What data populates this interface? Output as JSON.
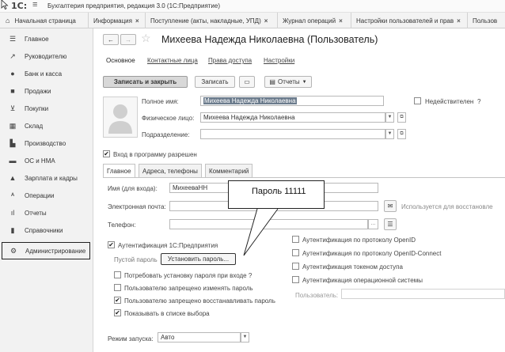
{
  "window": {
    "logo": "1С:",
    "title": "Бухгалтерия предприятия, редакция 3.0  (1С:Предприятие)"
  },
  "tabs": {
    "home": "Начальная страница",
    "items": [
      {
        "label": "Информация"
      },
      {
        "label": "Поступление (акты, накладные, УПД)"
      },
      {
        "label": "Журнал операций"
      },
      {
        "label": "Настройки пользователей и прав"
      },
      {
        "label": "Пользов"
      }
    ],
    "close_glyph": "×"
  },
  "sidebar": {
    "items": [
      {
        "label": "Главное",
        "icon": "menu-icon"
      },
      {
        "label": "Руководителю",
        "icon": "chart-line-icon"
      },
      {
        "label": "Банк и касса",
        "icon": "ruble-icon"
      },
      {
        "label": "Продажи",
        "icon": "bag-icon"
      },
      {
        "label": "Покупки",
        "icon": "cart-icon"
      },
      {
        "label": "Склад",
        "icon": "grid-icon"
      },
      {
        "label": "Производство",
        "icon": "factory-icon"
      },
      {
        "label": "ОС и НМА",
        "icon": "truck-icon"
      },
      {
        "label": "Зарплата и кадры",
        "icon": "person-icon"
      },
      {
        "label": "Операции",
        "icon": "operations-icon"
      },
      {
        "label": "Отчеты",
        "icon": "bar-chart-icon"
      },
      {
        "label": "Справочники",
        "icon": "book-icon"
      },
      {
        "label": "Администрирование",
        "icon": "gear-icon",
        "active": true
      }
    ]
  },
  "form": {
    "title": "Михеева Надежда Николаевна (Пользователь)",
    "nav": {
      "main": "Основное",
      "contacts": "Контактные лица",
      "access": "Права доступа",
      "settings": "Настройки"
    },
    "toolbar": {
      "save_close": "Записать и закрыть",
      "save": "Записать",
      "reports": "Отчеты"
    },
    "full_name_label": "Полное имя:",
    "full_name_value": "Михеева Надежда Николаевна",
    "inactive_label": "Недействителен",
    "help_glyph": "?",
    "person_label": "Физическое лицо:",
    "person_value": "Михеева Надежда Николаевна",
    "dept_label": "Подразделение:",
    "dept_value": "",
    "login_allowed": "Вход в программу разрешен",
    "subtabs": [
      "Главное",
      "Адреса, телефоны",
      "Комментарий"
    ],
    "login_name_label": "Имя (для входа):",
    "login_name_value": "МихееваНН",
    "email_label": "Электронная почта:",
    "email_value": "",
    "email_restore": "Используется для восстановле",
    "phone_label": "Телефон:",
    "phone_value": "",
    "auth_1c": "Аутентификация 1С:Предприятия",
    "empty_password": "Пустой пароль",
    "set_password": "Установить пароль...",
    "require_change": "Потребовать установку пароля при входе",
    "deny_change": "Пользователю запрещено изменять пароль",
    "deny_restore": "Пользователю запрещено восстанавливать пароль",
    "show_in_list": "Показывать в списке выбора",
    "openid": "Аутентификация по протоколу OpenID",
    "openid_connect": "Аутентификация по протоколу OpenID-Connect",
    "token_auth": "Аутентификация токеном доступа",
    "os_auth": "Аутентификация операционной системы",
    "os_user_label": "Пользователь:",
    "os_user_value": "",
    "launch_mode_label": "Режим запуска:",
    "launch_mode_value": "Авто",
    "checks": {
      "inactive": false,
      "login_allowed": true,
      "auth_1c": true,
      "require_change": false,
      "deny_change": false,
      "deny_restore": true,
      "show_in_list": true,
      "openid": false,
      "openid_connect": false,
      "token_auth": false,
      "os_auth": false
    }
  },
  "callout": {
    "text": "Пароль 11111"
  }
}
